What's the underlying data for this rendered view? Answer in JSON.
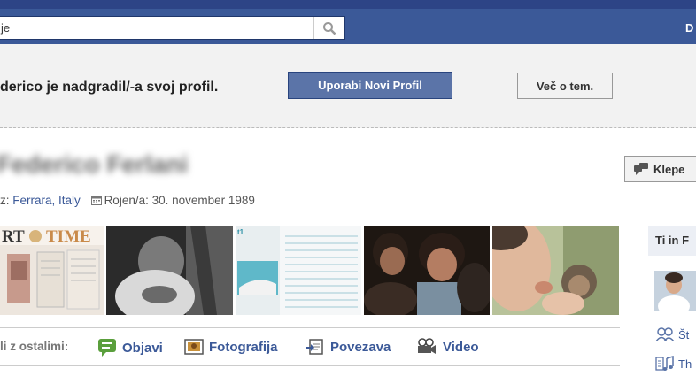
{
  "topbar": {
    "search_value": "je",
    "right_text": "D"
  },
  "banner": {
    "text": "derico je nadgradil/-a svoj profil.",
    "upgrade_label": "Uporabi Novi Profil",
    "more_label": "Več o tem."
  },
  "profile": {
    "name": "Federico Ferlani",
    "from_prefix": "z: ",
    "from_value": "Ferrara, Italy",
    "born_label": "Rojen/a: 30. november 1989",
    "poke_label": "Klepe"
  },
  "share": {
    "label": "li z ostalimi:",
    "items": [
      {
        "label": "Objavi",
        "icon": "speech-bubble-icon"
      },
      {
        "label": "Fotografija",
        "icon": "photo-icon"
      },
      {
        "label": "Povezava",
        "icon": "link-icon"
      },
      {
        "label": "Video",
        "icon": "video-camera-icon"
      }
    ]
  },
  "sidebar": {
    "heading": "Ti in F",
    "row1": "Št",
    "row2": "Th"
  },
  "colors": {
    "brand": "#3b5998",
    "banner_bg": "#f2f2f2",
    "button_blue": "#5b74a8"
  }
}
